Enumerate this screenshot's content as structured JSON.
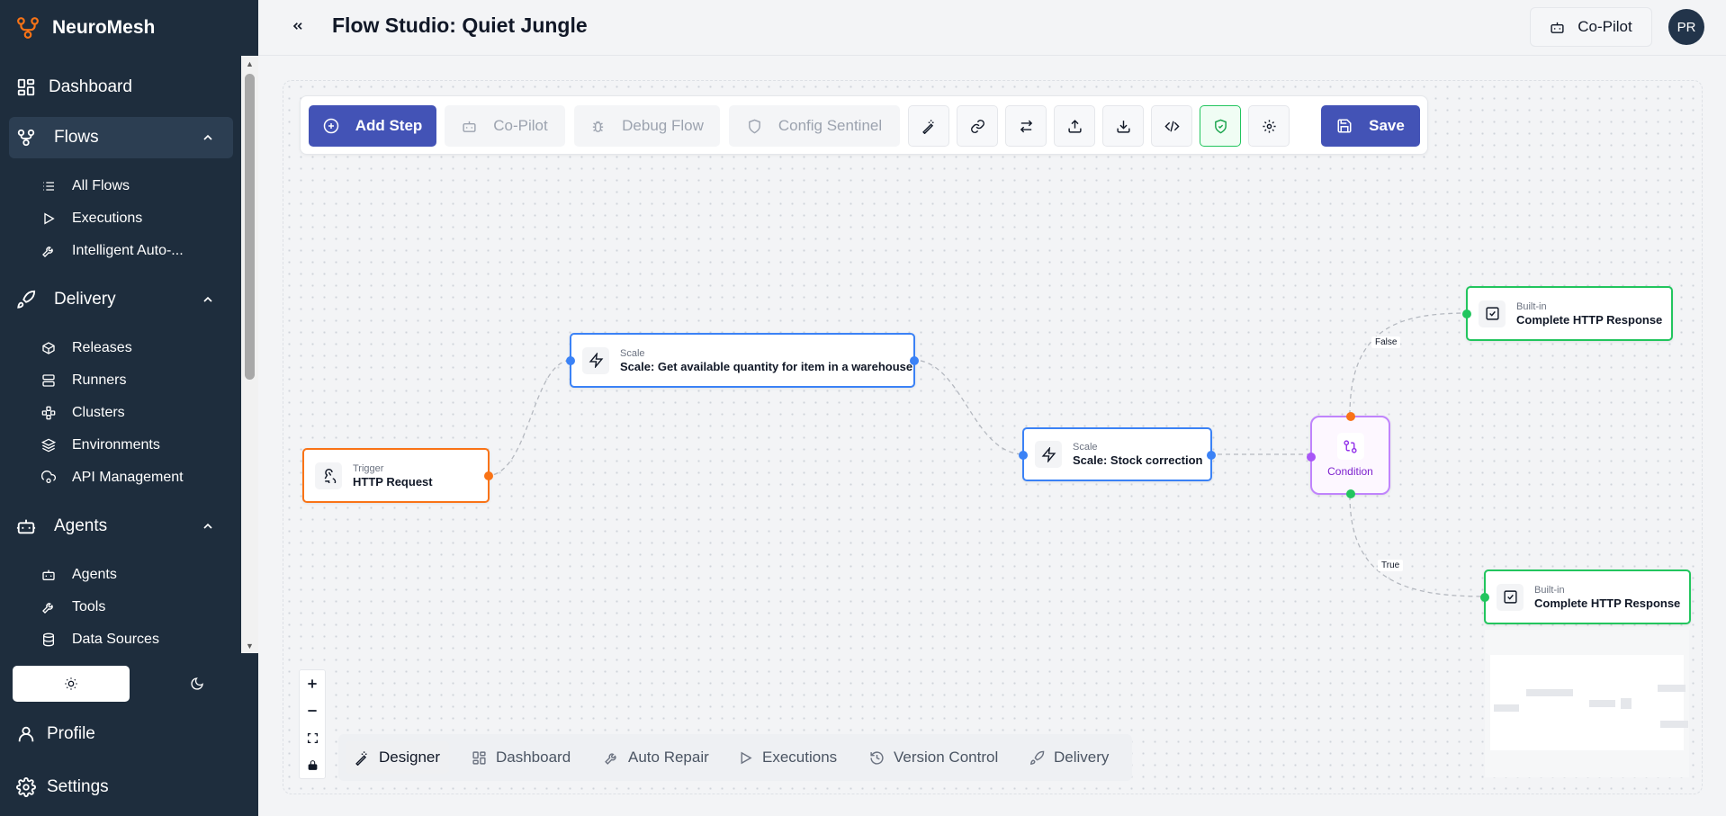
{
  "app": {
    "name": "NeuroMesh"
  },
  "header": {
    "title": "Flow Studio: Quiet Jungle",
    "copilot_label": "Co-Pilot",
    "avatar_initials": "PR"
  },
  "sidebar": {
    "dashboard": "Dashboard",
    "flows": {
      "label": "Flows",
      "items": [
        "All Flows",
        "Executions",
        "Intelligent Auto-..."
      ]
    },
    "delivery": {
      "label": "Delivery",
      "items": [
        "Releases",
        "Runners",
        "Clusters",
        "Environments",
        "API Management"
      ]
    },
    "agents": {
      "label": "Agents",
      "items": [
        "Agents",
        "Tools",
        "Data Sources"
      ]
    },
    "profile": "Profile",
    "settings": "Settings"
  },
  "toolbar": {
    "add_step": "Add Step",
    "copilot": "Co-Pilot",
    "debug_flow": "Debug Flow",
    "config_sentinel": "Config Sentinel",
    "save": "Save"
  },
  "nodes": {
    "trigger": {
      "type": "Trigger",
      "name": "HTTP Request"
    },
    "scale1": {
      "type": "Scale",
      "name": "Scale: Get available quantity for item in a warehouse"
    },
    "scale2": {
      "type": "Scale",
      "name": "Scale: Stock correction"
    },
    "condition": {
      "name": "Condition"
    },
    "response_false": {
      "type": "Built-in",
      "name": "Complete HTTP Response"
    },
    "response_true": {
      "type": "Built-in",
      "name": "Complete HTTP Response"
    }
  },
  "edges": {
    "false_label": "False",
    "true_label": "True"
  },
  "bottom_tabs": [
    "Designer",
    "Dashboard",
    "Auto Repair",
    "Executions",
    "Version Control",
    "Delivery"
  ],
  "colors": {
    "sidebar_bg": "#1e2d3d",
    "primary": "#4353b6",
    "trigger": "#f97316",
    "scale": "#3b82f6",
    "condition": "#c084fc",
    "builtin": "#22c55e"
  }
}
